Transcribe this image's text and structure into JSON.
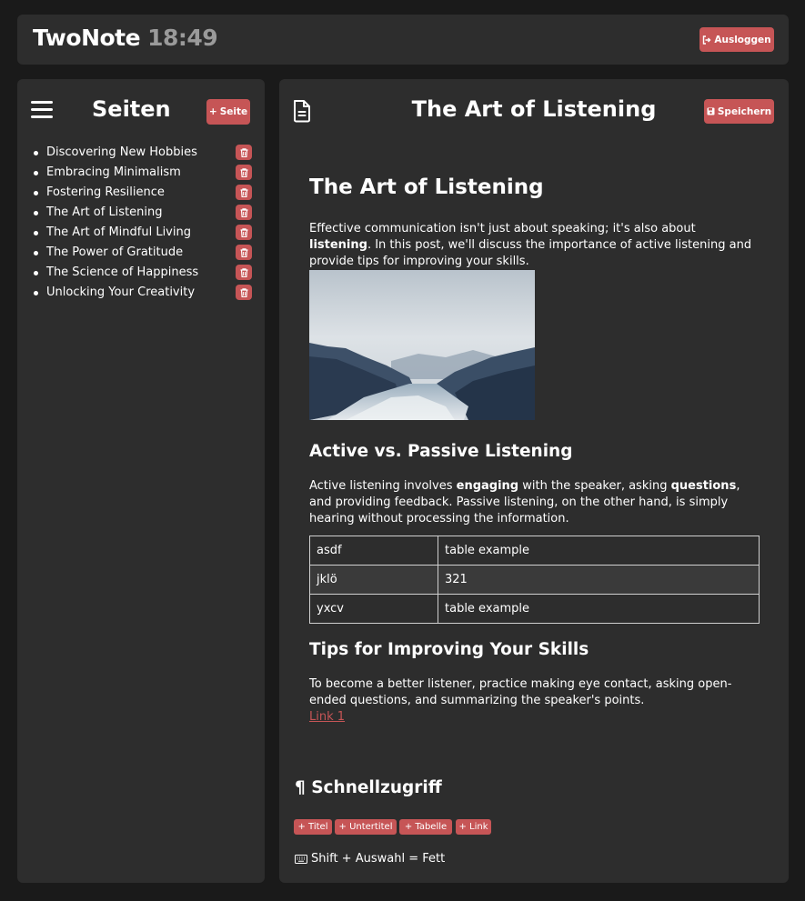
{
  "header": {
    "app_name": "TwoNote",
    "clock": "18:49",
    "logout_label": "Ausloggen"
  },
  "sidebar": {
    "title": "Seiten",
    "add_page_label": "Seite",
    "pages": [
      "Discovering New Hobbies",
      "Embracing Minimalism",
      "Fostering Resilience",
      "The Art of Listening",
      "The Art of Mindful Living",
      "The Power of Gratitude",
      "The Science of Happiness",
      "Unlocking Your Creativity"
    ]
  },
  "main": {
    "page_title": "The Art of Listening",
    "save_label": "Speichern",
    "post": {
      "title": "The Art of Listening",
      "intro_before": "Effective communication isn't just about speaking; it's also about ",
      "intro_bold": "listening",
      "intro_after": ". In this post, we'll discuss the importance of active listening and provide tips for improving your skills.",
      "section1_title": "Active vs. Passive Listening",
      "section1_a": "Active listening involves ",
      "section1_b": "engaging",
      "section1_c": " with the speaker, asking ",
      "section1_d": "questions",
      "section1_e": ", and providing feedback. Passive listening, on the other hand, is simply hearing without processing the information.",
      "table": [
        [
          "asdf",
          "table example"
        ],
        [
          "jklö",
          "321"
        ],
        [
          "yxcv",
          "table example"
        ]
      ],
      "section2_title": "Tips for Improving Your Skills",
      "section2_text": "To become a better listener, practice making eye contact, asking open-ended questions, and summarizing the speaker's points.",
      "link_label": "Link 1"
    },
    "quick_access": {
      "title": "Schnellzugriff",
      "buttons": [
        "+ Titel",
        "+ Untertitel",
        "+ Tabelle",
        "+ Link"
      ],
      "shortcut_hint": "Shift + Auswahl = Fett"
    }
  },
  "colors": {
    "accent": "#c65556",
    "background": "#1a1a1a",
    "panel": "#2d2d2d"
  }
}
